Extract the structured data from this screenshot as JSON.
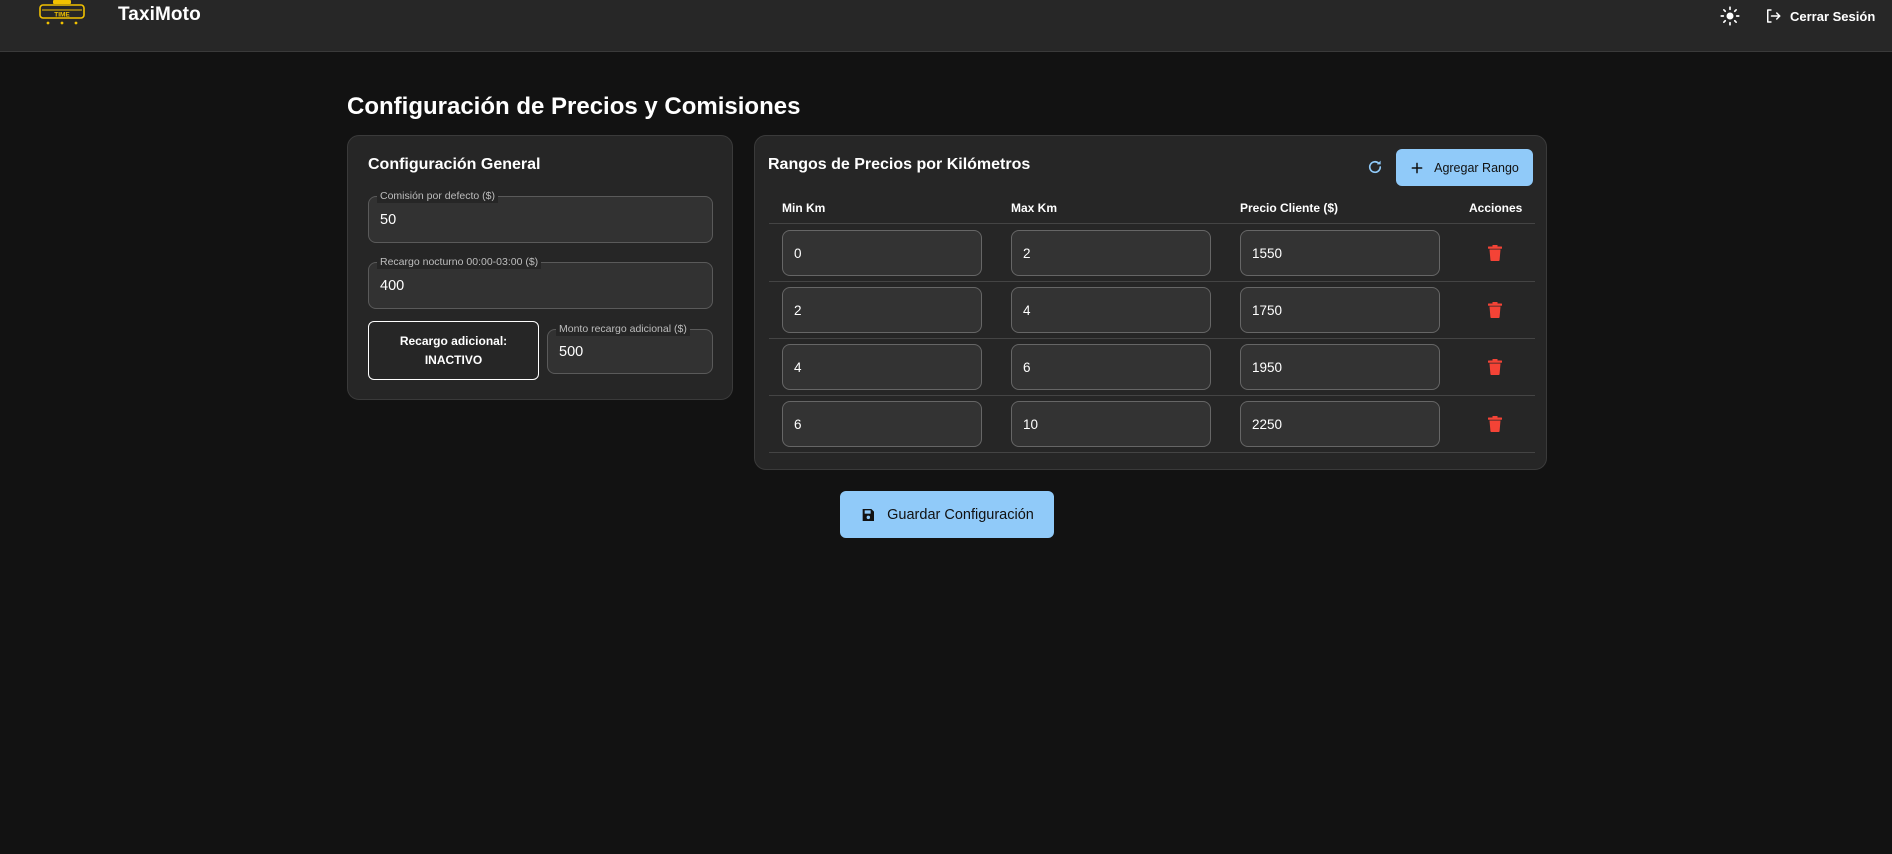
{
  "app": {
    "brand": "TaxiMoto",
    "logo_text": "TIME",
    "logout_label": "Cerrar Sesión"
  },
  "page": {
    "title": "Configuración de Precios y Comisiones"
  },
  "general": {
    "title": "Configuración General",
    "commission_label": "Comisión por defecto ($)",
    "commission_value": "50",
    "night_label": "Recargo nocturno 00:00-03:00 ($)",
    "night_value": "400",
    "extra_title": "Recargo adicional:",
    "extra_status": "INACTIVO",
    "extra_amount_label": "Monto recargo adicional ($)",
    "extra_amount_value": "500"
  },
  "ranges": {
    "title": "Rangos de Precios por Kilómetros",
    "add_label": "Agregar Rango",
    "headers": [
      "Min Km",
      "Max Km",
      "Precio Cliente ($)",
      "Acciones"
    ],
    "rows": [
      {
        "min": "0",
        "max": "2",
        "price": "1550"
      },
      {
        "min": "2",
        "max": "4",
        "price": "1750"
      },
      {
        "min": "4",
        "max": "6",
        "price": "1950"
      },
      {
        "min": "6",
        "max": "10",
        "price": "2250"
      }
    ]
  },
  "save_label": "Guardar Configuración",
  "colors": {
    "background": "#121212",
    "appbar": "#272727",
    "card": "#262626",
    "accent": "#90caf9",
    "delete": "#f44336",
    "logo": "#f2c200"
  },
  "icons": {
    "theme": "sun-icon",
    "logout": "logout-icon",
    "refresh": "refresh-icon",
    "add": "plus-icon",
    "delete": "trash-icon",
    "save": "save-icon"
  }
}
